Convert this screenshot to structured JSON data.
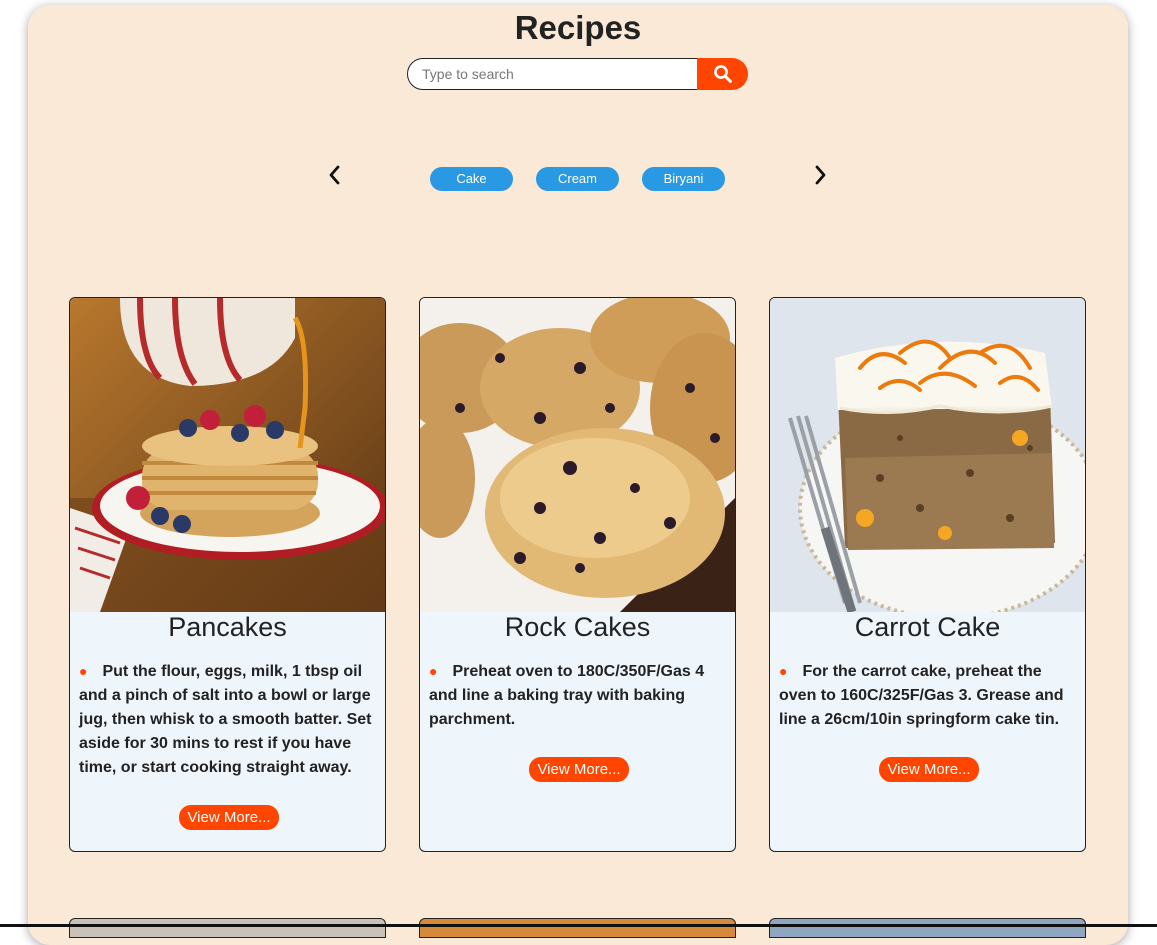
{
  "header": {
    "title": "Recipes"
  },
  "search": {
    "placeholder": "Type to search",
    "button_icon": "search-icon"
  },
  "categories": {
    "prev_icon": "chevron-left-icon",
    "next_icon": "chevron-right-icon",
    "items": [
      "Cake",
      "Cream",
      "Biryani"
    ]
  },
  "recipes": [
    {
      "title": "Pancakes",
      "description": "Put the flour, eggs, milk, 1 tbsp oil and a pinch of salt into a bowl or large jug, then whisk to a smooth batter. Set aside for 30 mins to rest if you have time, or start cooking straight away.",
      "button": "View More..."
    },
    {
      "title": "Rock Cakes",
      "description": "Preheat oven to 180C/350F/Gas 4 and line a baking tray with baking parchment.",
      "button": "View More..."
    },
    {
      "title": "Carrot Cake",
      "description": "For the carrot cake, preheat the oven to 160C/325F/Gas 3. Grease and line a 26cm/10in springform cake tin.",
      "button": "View More..."
    }
  ],
  "colors": {
    "panel_bg": "#fae9d7",
    "accent": "#ff4500",
    "chip": "#2899e2",
    "card_bg": "#eef6fc"
  }
}
